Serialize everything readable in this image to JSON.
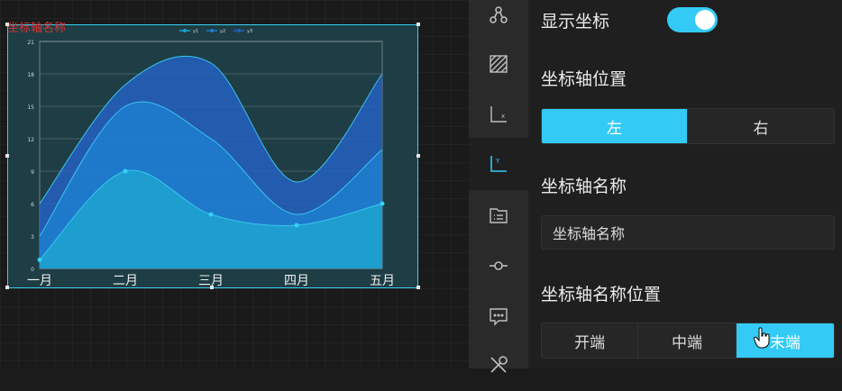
{
  "canvas": {
    "chart_name": "坐标轴名称"
  },
  "chart_data": {
    "type": "area",
    "title": "",
    "categories": [
      "一月",
      "二月",
      "三月",
      "四月",
      "五月"
    ],
    "series": [
      {
        "name": "y1",
        "values": [
          0.8,
          9,
          5,
          4,
          6
        ],
        "color": "#1fa3d0"
      },
      {
        "name": "y2",
        "values": [
          3,
          15,
          12,
          5,
          11
        ],
        "color": "#1d7fd0"
      },
      {
        "name": "y3",
        "values": [
          6,
          17,
          19,
          8,
          18
        ],
        "color": "#2460c2"
      }
    ],
    "y_ticks": [
      "0",
      "3",
      "6",
      "9",
      "12",
      "15",
      "18",
      "21"
    ],
    "ylim": [
      0,
      21
    ],
    "legend": "top-center",
    "grid": true,
    "accent": "#33d1f5"
  },
  "rail": {
    "icons": [
      "nodes-icon",
      "pattern-icon",
      "x-axis-icon",
      "y-axis-icon",
      "list-icon",
      "series-icon",
      "tooltip-icon",
      "tools-icon"
    ],
    "active": "y-axis-icon"
  },
  "panel": {
    "show_axis_label": "显示坐标",
    "show_axis_on": true,
    "axis_position_label": "坐标轴位置",
    "axis_position_options": [
      "左",
      "右"
    ],
    "axis_position_selected": "左",
    "axis_name_label": "坐标轴名称",
    "axis_name_value": "坐标轴名称",
    "axis_name_position_label": "坐标轴名称位置",
    "axis_name_position_options": [
      "开端",
      "中端",
      "末端"
    ],
    "axis_name_position_selected": "末端",
    "accent": "#33cbf5"
  }
}
